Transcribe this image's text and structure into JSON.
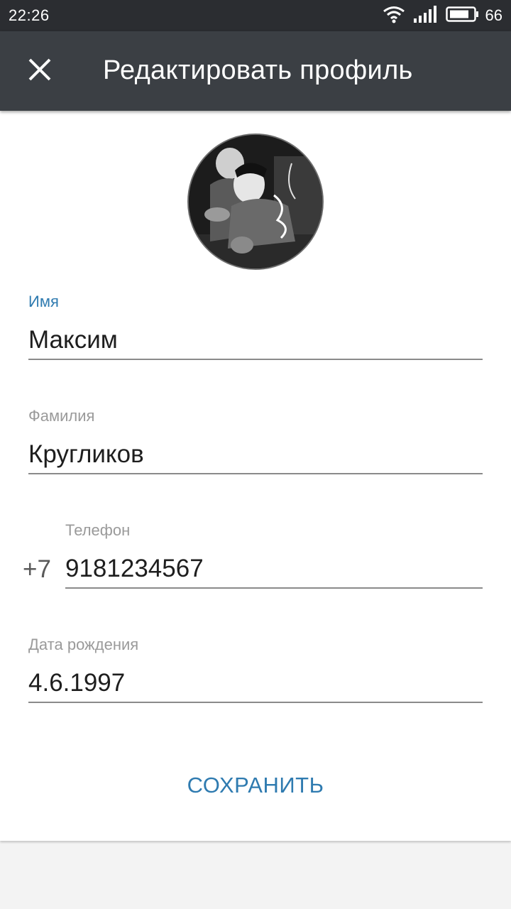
{
  "status_bar": {
    "time": "22:26",
    "battery_level": "66",
    "icons": [
      "wifi-icon",
      "signal-icon",
      "battery-icon"
    ]
  },
  "app_bar": {
    "title": "Редактировать профиль",
    "close_icon": "close-icon"
  },
  "profile": {
    "avatar_icon": "avatar-photo"
  },
  "form": {
    "first_name": {
      "label": "Имя",
      "value": "Максим"
    },
    "last_name": {
      "label": "Фамилия",
      "value": "Кругликов"
    },
    "phone": {
      "label": "Телефон",
      "prefix": "+7",
      "value": "9181234567"
    },
    "birth_date": {
      "label": "Дата рождения",
      "value": "4.6.1997"
    }
  },
  "actions": {
    "save_label": "СОХРАНИТЬ"
  },
  "colors": {
    "accent": "#2f7bb0",
    "app_bar": "#3b3f44",
    "status_bar": "#2b2d31"
  }
}
